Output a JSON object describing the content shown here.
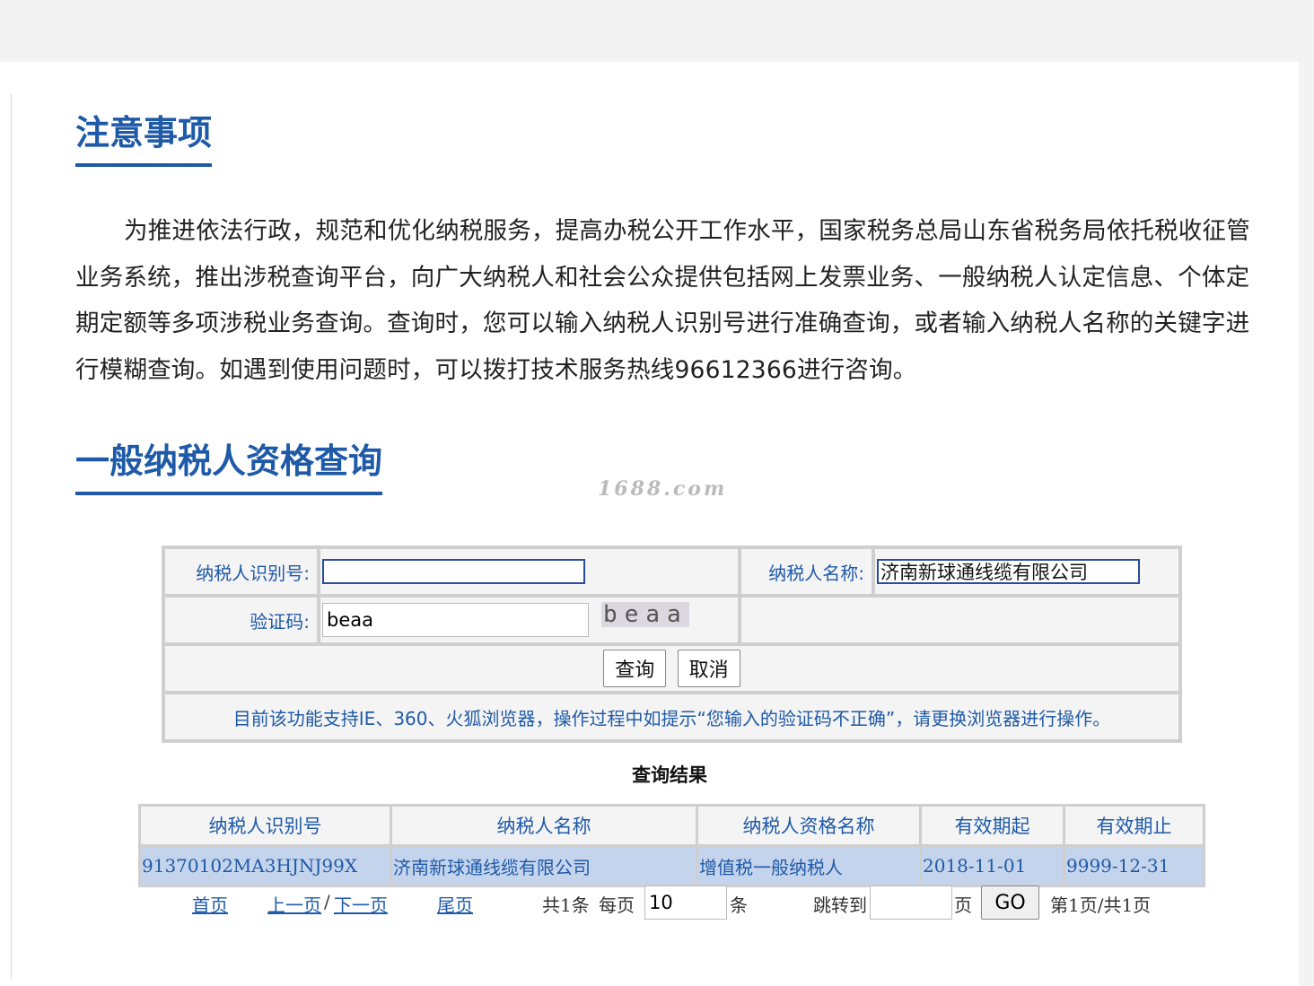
{
  "notice_section": {
    "title": "注意事项",
    "body": "为推进依法行政，规范和优化纳税服务，提高办税公开工作水平，国家税务总局山东省税务局依托税收征管业务系统，推出涉税查询平台，向广大纳税人和社会公众提供包括网上发票业务、一般纳税人认定信息、个体定期定额等多项涉税业务查询。查询时，您可以输入纳税人识别号进行准确查询，或者输入纳税人名称的关键字进行模糊查询。如遇到使用问题时，可以拨打技术服务热线96612366进行咨询。"
  },
  "query_section": {
    "title": "一般纳税人资格查询",
    "watermark": "1688.com"
  },
  "form": {
    "taxpayer_id_label": "纳税人识别号:",
    "taxpayer_id_value": "",
    "taxpayer_name_label": "纳税人名称:",
    "taxpayer_name_value": "济南新球通线缆有限公司",
    "captcha_label": "验证码:",
    "captcha_value": "beaa",
    "captcha_image_text": "beaa",
    "query_button": "查询",
    "cancel_button": "取消",
    "browser_notice": "目前该功能支持IE、360、火狐浏览器，操作过程中如提示“您输入的验证码不正确”，请更换浏览器进行操作。"
  },
  "results": {
    "title": "查询结果",
    "columns": [
      "纳税人识别号",
      "纳税人名称",
      "纳税人资格名称",
      "有效期起",
      "有效期止"
    ],
    "rows": [
      [
        "91370102MA3HJNJ99X",
        "济南新球通线缆有限公司",
        "增值税一般纳税人",
        "2018-11-01",
        "9999-12-31"
      ]
    ]
  },
  "pager": {
    "first": "首页",
    "prev": "上一页",
    "separator": "/",
    "next": "下一页",
    "last": "尾页",
    "total": "共1条",
    "per_page_label": "每页",
    "per_page_value": "10",
    "per_page_unit": "条",
    "jump_label": "跳转到",
    "jump_value": "",
    "jump_unit": "页",
    "go_button": "GO",
    "page_info": "第1页/共1页"
  }
}
